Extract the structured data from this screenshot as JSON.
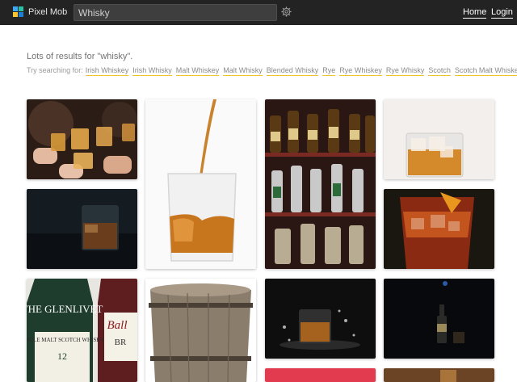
{
  "header": {
    "brand": "Pixel Mob",
    "search_value": "Whisky",
    "nav": {
      "home": "Home",
      "login": "Login"
    },
    "logo_colors": [
      "#3fa9f5",
      "#27c2a8",
      "#f7c531",
      "#1f7ed6"
    ]
  },
  "results": {
    "title": "Lots of results for \"whisky\".",
    "try_label": "Try searching for:",
    "suggestions": [
      "Irish Whiskey",
      "Irish Whisky",
      "Malt Whiskey",
      "Malt Whisky",
      "Blended Whisky",
      "Rye",
      "Rye Whiskey",
      "Rye Whisky",
      "Scotch",
      "Scotch Malt Whiskey"
    ]
  },
  "photos": {
    "p1": "toasting glasses",
    "p2": "whisky pour",
    "p3": "bar shelves",
    "p4": "whisky on ice",
    "p5": "dark whisky glass",
    "p6": "orange cocktail",
    "p7": "glenlivet bottle",
    "p8": "wooden barrel",
    "p9": "splash glass",
    "p10": "dark bottle",
    "glenlivet_brand": "THE GLENLIVET",
    "glenlivet_sub": "SINGLE MALT SCOTCH WHISKY",
    "glenlivet_age": "12",
    "ballantines_mark": "Ball",
    "ballantines_sub": "BR"
  },
  "colors": {
    "header_bg": "#232323",
    "accent_underline": "#f0c230"
  }
}
